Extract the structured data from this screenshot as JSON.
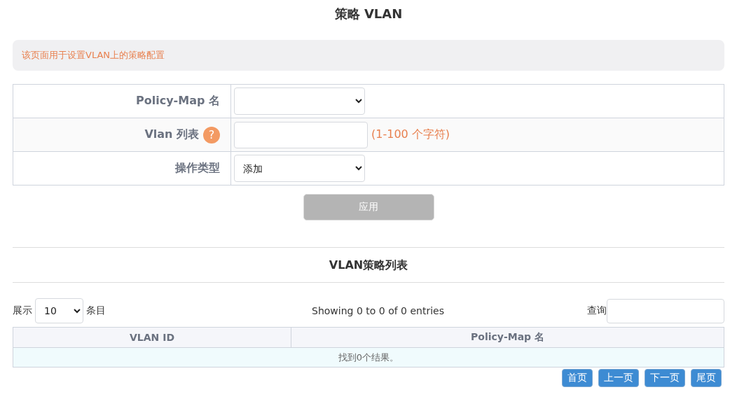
{
  "title": "策略 VLAN",
  "info": "该页面用于设置VLAN上的策略配置",
  "form": {
    "rows": [
      {
        "kind": "select",
        "label": "Policy-Map 名"
      },
      {
        "kind": "input",
        "label": "Vlan 列表",
        "help": "?",
        "hint": "(1-100 个字符)"
      },
      {
        "kind": "select",
        "label": "操作类型",
        "value": "添加"
      }
    ],
    "apply": {
      "label": "应用",
      "disabled": true
    }
  },
  "list": {
    "title": "VLAN策略列表",
    "show_label": "展示",
    "page_size": "10",
    "entries_label": "条目",
    "info": "Showing 0 to 0 of 0 entries",
    "search_label": "查询",
    "columns": [
      "VLAN ID",
      "Policy-Map 名"
    ],
    "empty": "找到0个结果。",
    "pager": [
      "首页",
      "上一页",
      "下一页",
      "尾页"
    ]
  }
}
